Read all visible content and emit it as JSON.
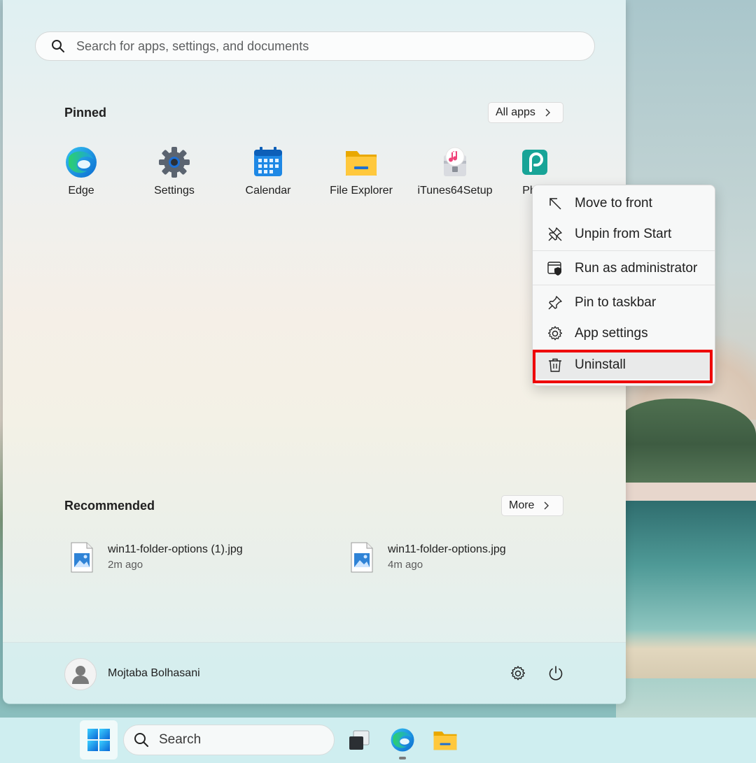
{
  "start_menu": {
    "search_placeholder": "Search for apps, settings, and documents",
    "pinned": {
      "title": "Pinned",
      "all_apps_label": "All apps",
      "apps": [
        {
          "label": "Edge",
          "icon": "edge-icon"
        },
        {
          "label": "Settings",
          "icon": "settings-gear-icon"
        },
        {
          "label": "Calendar",
          "icon": "calendar-icon"
        },
        {
          "label": "File Explorer",
          "icon": "folder-icon"
        },
        {
          "label": "iTunes64Setup",
          "icon": "itunes-setup-icon"
        },
        {
          "label": "Ph",
          "icon": "photopea-icon"
        }
      ]
    },
    "recommended": {
      "title": "Recommended",
      "more_label": "More",
      "items": [
        {
          "name": "win11-folder-options (1).jpg",
          "time": "2m ago",
          "icon": "image-file-icon"
        },
        {
          "name": "win11-folder-options.jpg",
          "time": "4m ago",
          "icon": "image-file-icon"
        }
      ]
    },
    "footer": {
      "username": "Mojtaba Bolhasani",
      "settings_icon": "gear-icon",
      "power_icon": "power-icon"
    }
  },
  "context_menu": {
    "items": [
      {
        "label": "Move to front",
        "icon": "arrow-up-left-icon"
      },
      {
        "label": "Unpin from Start",
        "icon": "unpin-icon"
      },
      {
        "label": "Run as administrator",
        "icon": "shield-window-icon"
      },
      {
        "label": "Pin to taskbar",
        "icon": "pin-icon"
      },
      {
        "label": "App settings",
        "icon": "gear-icon"
      },
      {
        "label": "Uninstall",
        "icon": "trash-icon"
      }
    ],
    "highlighted_item": "Uninstall",
    "highlight_color": "#ee0000"
  },
  "taskbar": {
    "search_placeholder": "Search",
    "icons": [
      "windows-start-icon",
      "task-view-icon",
      "edge-icon",
      "file-explorer-icon"
    ]
  }
}
